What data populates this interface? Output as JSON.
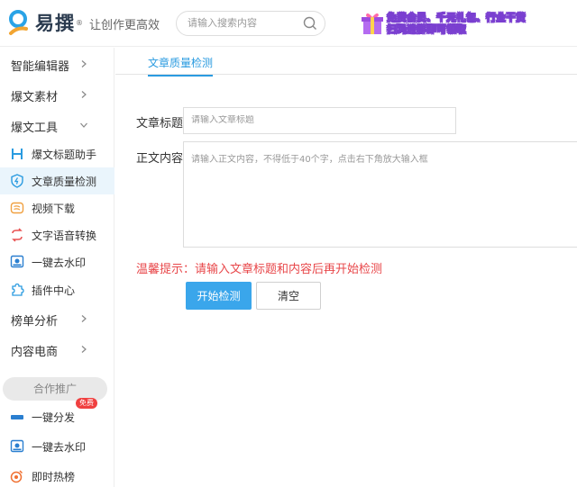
{
  "header": {
    "logo_text": "易撰",
    "logo_reg": "®",
    "slogan": "让创作更高效",
    "search_placeholder": "请输入搜索内容",
    "promo_line1": "免费会员、千元礼包、行业干货",
    "promo_line2": "扫码进群即可领取"
  },
  "sidebar": {
    "groups": [
      {
        "label": "智能编辑器",
        "icon": "chevron-right-icon"
      },
      {
        "label": "爆文素材",
        "icon": "chevron-right-icon"
      },
      {
        "label": "爆文工具",
        "icon": "chevron-down-icon"
      }
    ],
    "tools": [
      {
        "label": "爆文标题助手",
        "icon": "h-letter-icon"
      },
      {
        "label": "文章质量检测",
        "icon": "shield-icon",
        "active": true
      },
      {
        "label": "视频下载",
        "icon": "video-icon"
      },
      {
        "label": "文字语音转换",
        "icon": "convert-icon"
      },
      {
        "label": "一键去水印",
        "icon": "watermark-icon"
      },
      {
        "label": "插件中心",
        "icon": "puzzle-icon"
      }
    ],
    "groups2": [
      {
        "label": "榜单分析",
        "icon": "chevron-right-icon"
      },
      {
        "label": "内容电商",
        "icon": "chevron-right-icon"
      }
    ],
    "coop_label": "合作推广",
    "coop_items": [
      {
        "label": "一键分发",
        "icon": "share-icon",
        "badge": "免费"
      },
      {
        "label": "一键去水印",
        "icon": "watermark-icon"
      },
      {
        "label": "即时热榜",
        "icon": "fire-icon"
      }
    ]
  },
  "main": {
    "tab_label": "文章质量检测",
    "title_label": "文章标题",
    "title_placeholder": "请输入文章标题",
    "content_label": "正文内容",
    "content_placeholder": "请输入正文内容，不得低于40个字，点击右下角放大输入框",
    "tip": "温馨提示：请输入文章标题和内容后再开始检测",
    "start_button": "开始检测",
    "clear_button": "清空"
  },
  "colors": {
    "accent": "#2a9be0",
    "button": "#3aa6eb",
    "warning": "#e8474a",
    "active_bg": "#eaf5fc"
  }
}
